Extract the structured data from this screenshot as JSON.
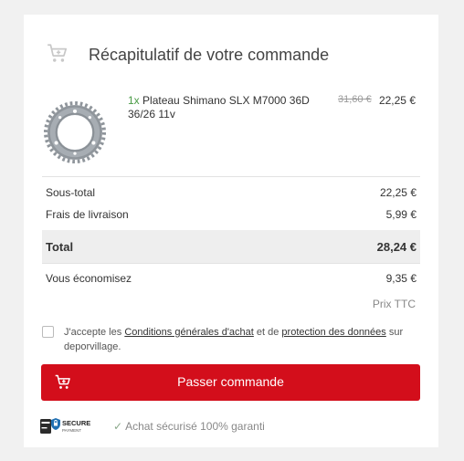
{
  "header": {
    "title": "Récapitulatif de votre commande",
    "icon": "shopping-cart-icon"
  },
  "product": {
    "qty": "1x",
    "name": "Plateau Shimano SLX M7000 36D 36/26 11v",
    "old_price": "31,60 €",
    "price": "22,25 €",
    "image": "chainring-image"
  },
  "summary": {
    "subtotal_label": "Sous-total",
    "subtotal_value": "22,25 €",
    "shipping_label": "Frais de livraison",
    "shipping_value": "5,99 €",
    "total_label": "Total",
    "total_value": "28,24 €",
    "savings_label": "Vous économisez",
    "savings_value": "9,35 €",
    "tax_note": "Prix TTC"
  },
  "consent": {
    "prefix": "J'accepte les ",
    "terms_link": "Conditions générales d'achat",
    "middle": " et de ",
    "privacy_link": "protection des données",
    "suffix": " sur deporvillage.",
    "checked": false
  },
  "cta": {
    "label": "Passer commande",
    "color": "#d30e1b",
    "icon": "shopping-cart-icon"
  },
  "secure": {
    "badge_line1": "SECURE",
    "badge_line2": "PAYMENT",
    "text": "Achat sécurisé 100% garanti",
    "icon": "check-icon"
  }
}
